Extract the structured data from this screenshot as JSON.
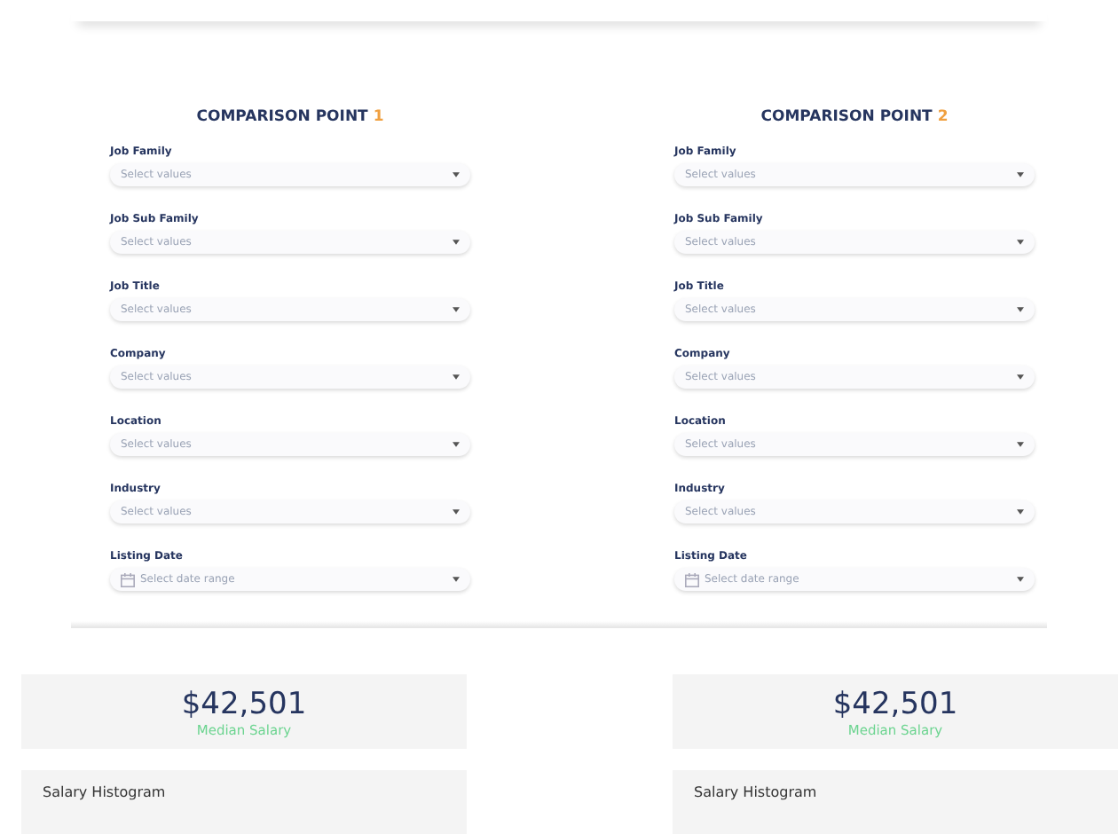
{
  "comparison_points": [
    {
      "title": "COMPARISON POINT",
      "number": "1",
      "filters": [
        {
          "label": "Job Family",
          "kind": "select",
          "placeholder": "Select values"
        },
        {
          "label": "Job Sub Family",
          "kind": "select",
          "placeholder": "Select values"
        },
        {
          "label": "Job Title",
          "kind": "select",
          "placeholder": "Select values"
        },
        {
          "label": "Company",
          "kind": "select",
          "placeholder": "Select values"
        },
        {
          "label": "Location",
          "kind": "select",
          "placeholder": "Select values"
        },
        {
          "label": "Industry",
          "kind": "select",
          "placeholder": "Select values"
        },
        {
          "label": "Listing Date",
          "kind": "date",
          "placeholder": "Select date range"
        }
      ],
      "median": {
        "value": "$42,501",
        "label": "Median Salary"
      },
      "histogram": {
        "title": "Salary Histogram"
      }
    },
    {
      "title": "COMPARISON POINT",
      "number": "2",
      "filters": [
        {
          "label": "Job Family",
          "kind": "select",
          "placeholder": "Select values"
        },
        {
          "label": "Job Sub Family",
          "kind": "select",
          "placeholder": "Select values"
        },
        {
          "label": "Job Title",
          "kind": "select",
          "placeholder": "Select values"
        },
        {
          "label": "Company",
          "kind": "select",
          "placeholder": "Select values"
        },
        {
          "label": "Location",
          "kind": "select",
          "placeholder": "Select values"
        },
        {
          "label": "Industry",
          "kind": "select",
          "placeholder": "Select values"
        },
        {
          "label": "Listing Date",
          "kind": "date",
          "placeholder": "Select date range"
        }
      ],
      "median": {
        "value": "$42,501",
        "label": "Median Salary"
      },
      "histogram": {
        "title": "Salary Histogram"
      }
    }
  ]
}
